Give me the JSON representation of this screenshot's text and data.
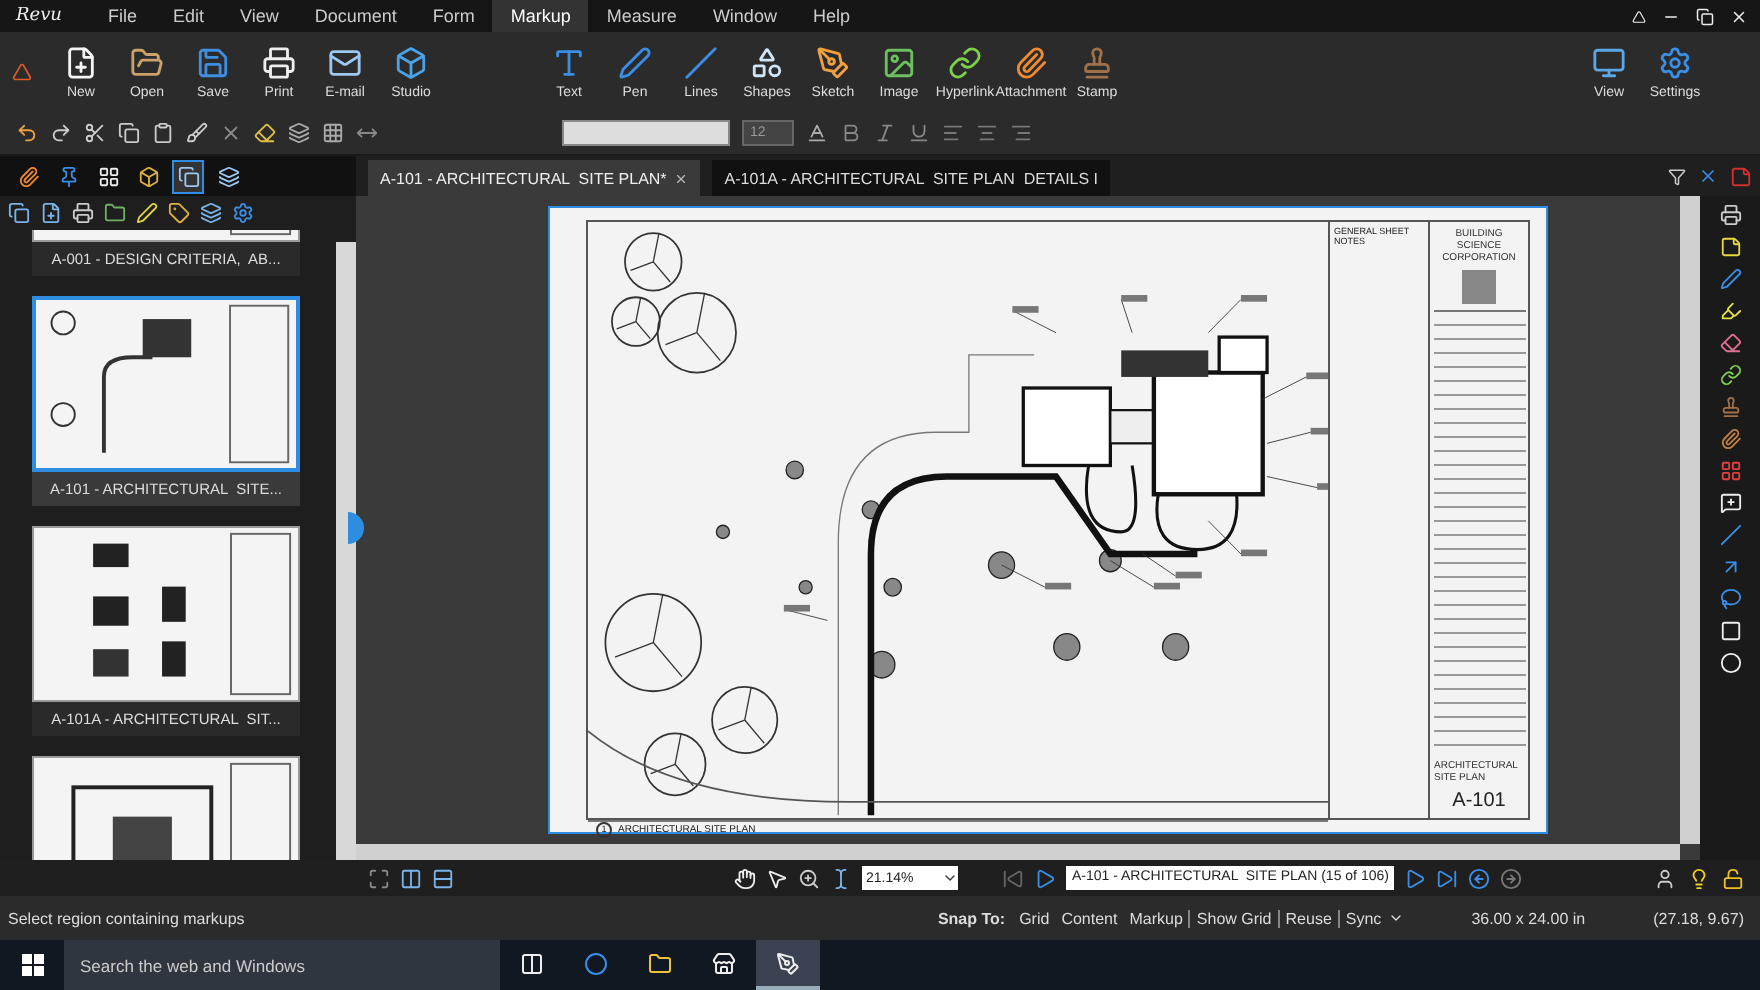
{
  "app": {
    "logo": "Revu"
  },
  "menu": [
    {
      "label": "File",
      "selected": false
    },
    {
      "label": "Edit",
      "selected": false
    },
    {
      "label": "View",
      "selected": false
    },
    {
      "label": "Document",
      "selected": false
    },
    {
      "label": "Form",
      "selected": false
    },
    {
      "label": "Markup",
      "selected": true
    },
    {
      "label": "Measure",
      "selected": false
    },
    {
      "label": "Window",
      "selected": false
    },
    {
      "label": "Help",
      "selected": false
    }
  ],
  "ribbon": {
    "file_tools": [
      "New",
      "Open",
      "Save",
      "Print",
      "E-mail",
      "Studio"
    ],
    "markup_tools": [
      "Text",
      "Pen",
      "Lines",
      "Shapes",
      "Sketch",
      "Image",
      "Hyperlink",
      "Attachment",
      "Stamp"
    ],
    "app_tools": [
      "View",
      "Settings"
    ]
  },
  "format_bar": {
    "font_size": "12"
  },
  "panel_tabs": [
    {
      "selected": false
    },
    {
      "selected": false
    },
    {
      "selected": false
    },
    {
      "selected": false
    },
    {
      "selected": true
    },
    {
      "selected": false
    }
  ],
  "document_tabs": [
    {
      "label": "A-101 - ARCHITECTURAL  SITE PLAN*",
      "selected": true
    },
    {
      "label": "A-101A - ARCHITECTURAL  SITE PLAN  DETAILS I",
      "selected": false
    }
  ],
  "thumbnails": [
    {
      "label": "A-001 - DESIGN CRITERIA,  AB...",
      "selected": false,
      "kind": "plan"
    },
    {
      "label": "A-101 - ARCHITECTURAL  SITE...",
      "selected": true,
      "kind": "site"
    },
    {
      "label": "A-101A - ARCHITECTURAL  SIT...",
      "selected": false,
      "kind": "details"
    },
    {
      "selected": false,
      "kind": "plan"
    }
  ],
  "drawing": {
    "view_number": "1",
    "view_title": "ARCHITECTURAL SITE PLAN",
    "notes_title": "GENERAL SHEET NOTES",
    "company": "BUILDING SCIENCE CORPORATION",
    "sheet_title": "ARCHITECTURAL SITE PLAN",
    "sheet_number": "A-101"
  },
  "navigation": {
    "zoom": "21.14%",
    "page": "A-101 - ARCHITECTURAL  SITE PLAN (15 of 106)"
  },
  "status_bar": {
    "message": "Select region containing markups",
    "snap_label": "Snap To:",
    "toggles": [
      "Grid",
      "Content",
      "Markup",
      "Show Grid",
      "Reuse",
      "Sync"
    ],
    "page_size": "36.00 x 24.00 in",
    "cursor": "(27.18, 9.67)"
  },
  "taskbar": {
    "search_placeholder": "Search the web and Windows"
  }
}
